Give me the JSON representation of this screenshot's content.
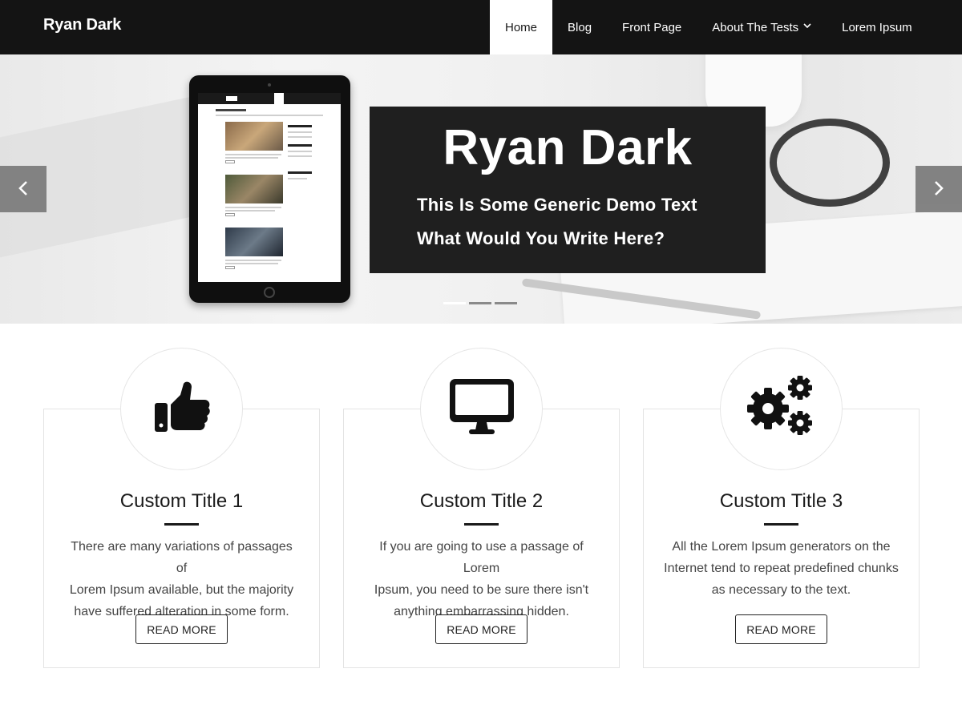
{
  "header": {
    "brand": "Ryan Dark",
    "nav": [
      {
        "label": "Home",
        "active": true
      },
      {
        "label": "Blog"
      },
      {
        "label": "Front Page"
      },
      {
        "label": "About The Tests",
        "has_dropdown": true
      },
      {
        "label": "Lorem Ipsum"
      }
    ]
  },
  "slider": {
    "title": "Ryan Dark",
    "line1": "This Is Some Generic Demo Text",
    "line2": "What Would You Write Here?",
    "prev_icon": "chevron-left-icon",
    "next_icon": "chevron-right-icon",
    "slide_count": 3,
    "active_slide": 1
  },
  "features": [
    {
      "icon": "thumbs-up-icon",
      "title": "Custom Title 1",
      "text_lines": [
        "There are many variations of passages of",
        "Lorem Ipsum available, but the majority",
        "have suffered alteration in some form."
      ],
      "button": "READ MORE"
    },
    {
      "icon": "monitor-icon",
      "title": "Custom Title 2",
      "text_lines": [
        "If you are going to use a passage of Lorem",
        "Ipsum, you need to be sure there isn't",
        "anything embarrassing hidden."
      ],
      "button": "READ MORE"
    },
    {
      "icon": "gears-icon",
      "title": "Custom Title 3",
      "text_lines": [
        "All the Lorem Ipsum generators on the",
        "Internet tend to repeat predefined chunks",
        "as necessary to the text."
      ],
      "button": "READ MORE"
    }
  ],
  "colors": {
    "header_bg": "#141414",
    "caption_bg": "#1f1f1f",
    "accent": "#1a1a1a"
  }
}
